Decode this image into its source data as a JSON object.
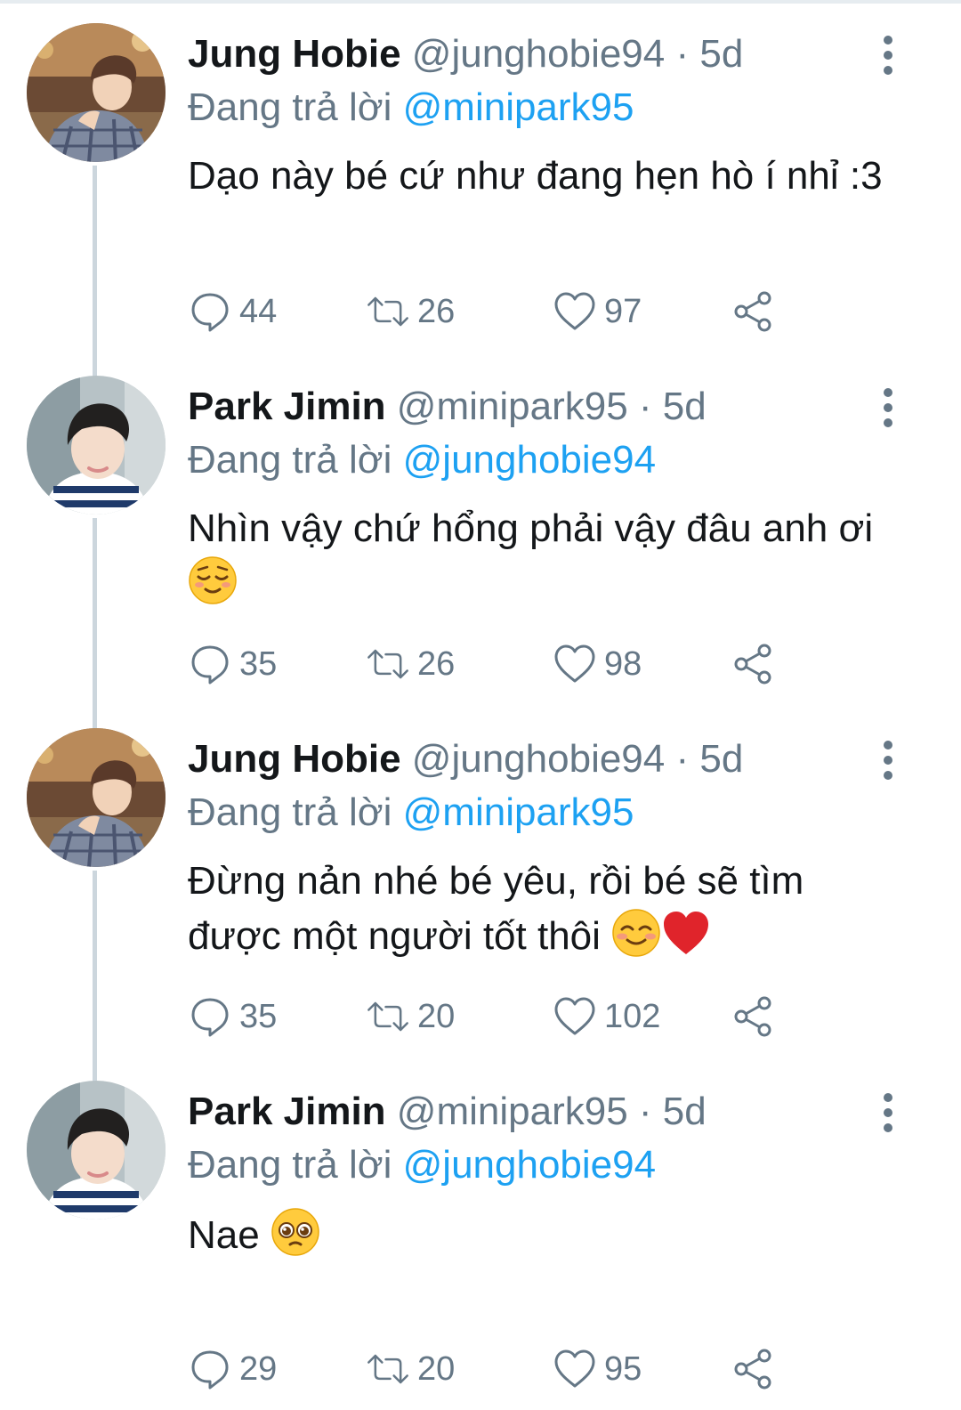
{
  "tweets": [
    {
      "name": "Jung Hobie",
      "handle": "@junghobie94",
      "sep": "·",
      "time": "5d",
      "reply_prefix": "Đang trả lời",
      "reply_to": "@minipark95",
      "text": "Dạo này bé cứ như đang hẹn hò í nhỉ :3",
      "emojis": [],
      "replies": "44",
      "retweets": "26",
      "likes": "97",
      "avatar": "hobie"
    },
    {
      "name": "Park Jimin",
      "handle": "@minipark95",
      "sep": "·",
      "time": "5d",
      "reply_prefix": "Đang trả lời",
      "reply_to": "@junghobie94",
      "text": "Nhìn vậy chứ hổng phải vậy đâu anh ơi",
      "emojis": [
        "relieved-face-emoji"
      ],
      "replies": "35",
      "retweets": "26",
      "likes": "98",
      "avatar": "jimin"
    },
    {
      "name": "Jung Hobie",
      "handle": "@junghobie94",
      "sep": "·",
      "time": "5d",
      "reply_prefix": "Đang trả lời",
      "reply_to": "@minipark95",
      "text": "Đừng nản nhé bé yêu, rồi bé sẽ tìm được một người tốt thôi",
      "emojis": [
        "smiling-face-emoji",
        "red-heart-emoji"
      ],
      "replies": "35",
      "retweets": "20",
      "likes": "102",
      "avatar": "hobie"
    },
    {
      "name": "Park Jimin",
      "handle": "@minipark95",
      "sep": "·",
      "time": "5d",
      "reply_prefix": "Đang trả lời",
      "reply_to": "@junghobie94",
      "text": "Nae",
      "emojis": [
        "pleading-face-emoji"
      ],
      "replies": "29",
      "retweets": "20",
      "likes": "95",
      "avatar": "jimin"
    }
  ],
  "icons": {
    "reply": "reply-icon",
    "retweet": "retweet-icon",
    "like": "heart-icon",
    "share": "share-icon",
    "more": "more-vertical-icon"
  },
  "colors": {
    "text": "#14171a",
    "muted": "#657786",
    "link": "#1da1f2",
    "thread_line": "#ccd6dd"
  }
}
